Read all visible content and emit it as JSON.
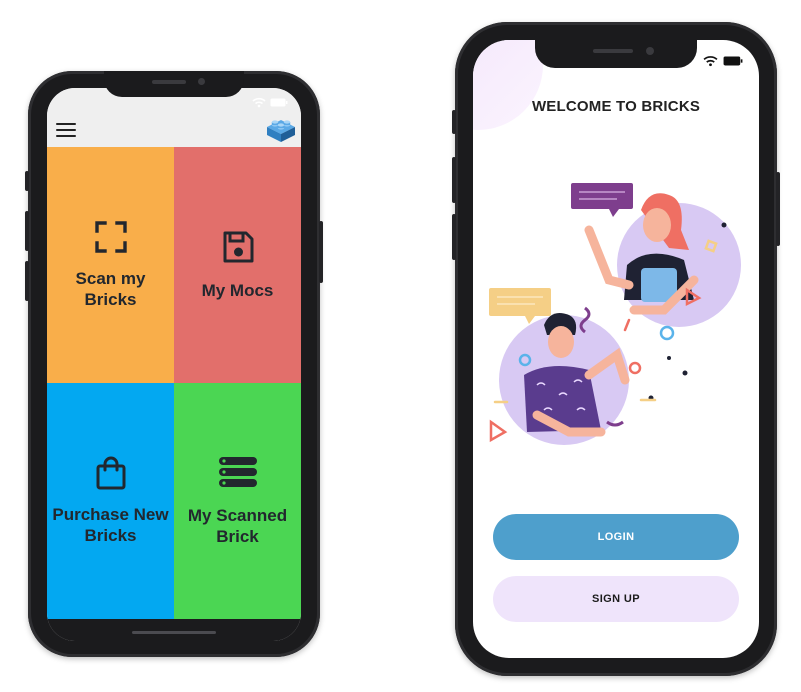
{
  "menu_screen": {
    "tiles": [
      {
        "id": "scan",
        "label": "Scan my Bricks",
        "icon": "scan-frame-icon",
        "color": "#f9ae4a"
      },
      {
        "id": "mocs",
        "label": "My Mocs",
        "icon": "floppy-disk-icon",
        "color": "#e26f6b"
      },
      {
        "id": "purchase",
        "label": "Purchase New Bricks",
        "icon": "shopping-bag-icon",
        "color": "#03a8f1"
      },
      {
        "id": "scanned",
        "label": "My Scanned Brick",
        "icon": "server-stack-icon",
        "color": "#4bd653"
      }
    ],
    "topbar": {
      "menu_icon": "hamburger-menu-icon",
      "logo_icon": "lego-brick-icon"
    }
  },
  "welcome_screen": {
    "title": "WELCOME TO BRICKS",
    "login_label": "LOGIN",
    "signup_label": "SIGN UP",
    "login_color": "#4e9fcc",
    "signup_color": "#efe4fb"
  }
}
